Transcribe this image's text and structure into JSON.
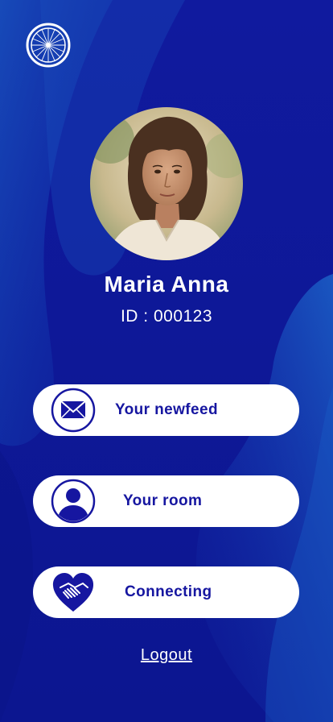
{
  "app": {
    "logo_icon": "bicycle-wheel-icon"
  },
  "profile": {
    "name": "Maria Anna",
    "id_text": "ID : 000123",
    "avatar_alt": "Maria Anna"
  },
  "menu": {
    "items": [
      {
        "label": "Your newfeed",
        "icon": "envelope-icon"
      },
      {
        "label": "Your room",
        "icon": "user-icon"
      },
      {
        "label": "Connecting",
        "icon": "handshake-heart-icon"
      }
    ]
  },
  "logout": {
    "label": "Logout"
  },
  "colors": {
    "background": "#0f1aa0",
    "accent": "#1616a0",
    "button_bg": "#ffffff",
    "text_light": "#ffffff"
  }
}
